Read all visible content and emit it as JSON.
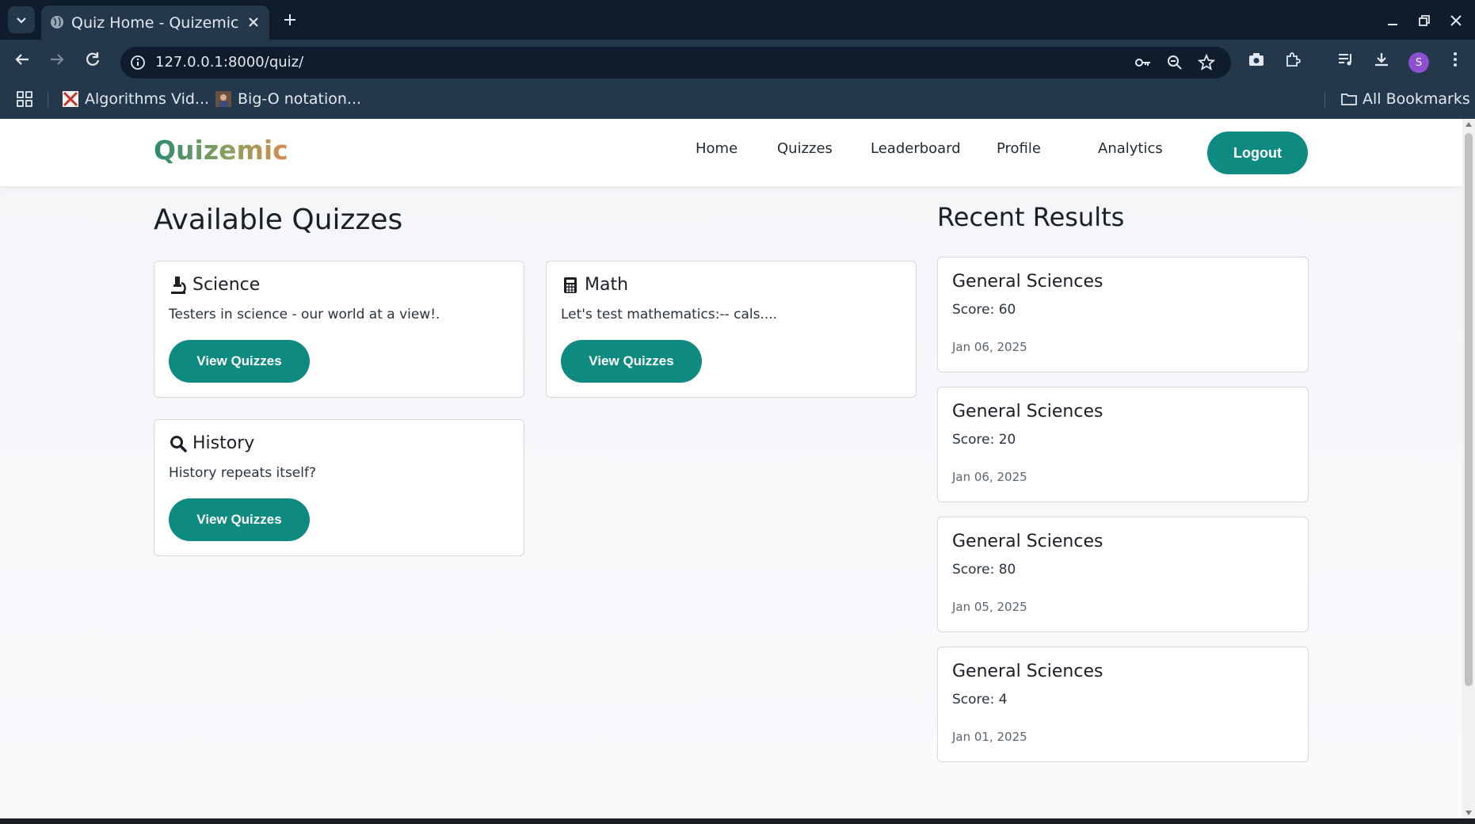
{
  "browser": {
    "tab_title": "Quiz Home - Quizemic",
    "url": "127.0.0.1:8000/quiz/",
    "profile_initial": "S",
    "bookmarks": [
      "Algorithms Vid...",
      "Big-O notation..."
    ],
    "all_bookmarks_label": "All Bookmarks"
  },
  "site": {
    "brand": "Quizemic",
    "nav": [
      "Home",
      "Quizzes",
      "Leaderboard",
      "Profile",
      "Analytics"
    ],
    "logout_label": "Logout"
  },
  "available": {
    "title": "Available Quizzes",
    "quizzes": [
      {
        "name": "Science",
        "icon": "microscope-icon",
        "description": "Testers in science - our world at a view!.",
        "button": "View Quizzes"
      },
      {
        "name": "Math",
        "icon": "calculator-icon",
        "description": "Let's test mathematics:-- cals....",
        "button": "View Quizzes"
      },
      {
        "name": "History",
        "icon": "search-icon",
        "description": "History repeats itself?",
        "button": "View Quizzes"
      }
    ]
  },
  "recent": {
    "title": "Recent Results",
    "results": [
      {
        "quiz": "General Sciences",
        "score": "Score: 60",
        "date": "Jan 06, 2025"
      },
      {
        "quiz": "General Sciences",
        "score": "Score: 20",
        "date": "Jan 06, 2025"
      },
      {
        "quiz": "General Sciences",
        "score": "Score: 80",
        "date": "Jan 05, 2025"
      },
      {
        "quiz": "General Sciences",
        "score": "Score: 4",
        "date": "Jan 01, 2025"
      }
    ]
  },
  "colors": {
    "accent": "#0f8a80",
    "chrome_dark": "#0f1c2b",
    "chrome": "#24384c"
  }
}
